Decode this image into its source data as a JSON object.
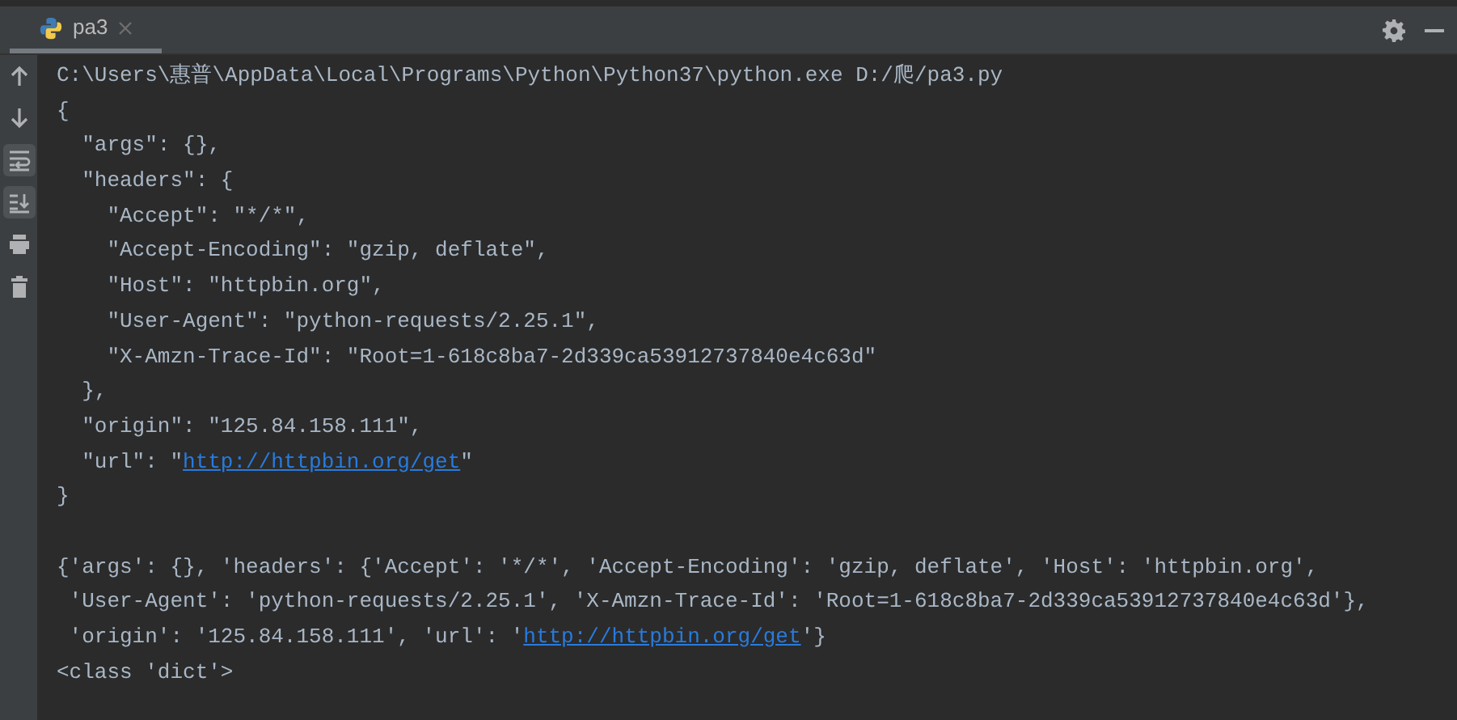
{
  "tabs": [
    {
      "label": "pa3",
      "selected": true
    }
  ],
  "toolbar": [
    {
      "kind": "up",
      "on": false
    },
    {
      "kind": "down",
      "on": false
    },
    {
      "kind": "wrap",
      "on": true
    },
    {
      "kind": "scroll",
      "on": true
    },
    {
      "kind": "print",
      "on": false
    },
    {
      "kind": "trash",
      "on": false
    }
  ],
  "console": {
    "lines": [
      {
        "kind": "output",
        "segments": [
          {
            "kind": "text",
            "text": "C:\\Users\\惠普\\AppData\\Local\\Programs\\Python\\Python37\\python.exe D:/爬/pa3.py"
          }
        ]
      },
      {
        "kind": "output",
        "segments": [
          {
            "kind": "text",
            "text": "{"
          }
        ]
      },
      {
        "kind": "output",
        "segments": [
          {
            "kind": "text",
            "text": "  \"args\": {},"
          }
        ]
      },
      {
        "kind": "output",
        "segments": [
          {
            "kind": "text",
            "text": "  \"headers\": {"
          }
        ]
      },
      {
        "kind": "output",
        "segments": [
          {
            "kind": "text",
            "text": "    \"Accept\": \"*/*\","
          }
        ]
      },
      {
        "kind": "output",
        "segments": [
          {
            "kind": "text",
            "text": "    \"Accept-Encoding\": \"gzip, deflate\","
          }
        ]
      },
      {
        "kind": "output",
        "segments": [
          {
            "kind": "text",
            "text": "    \"Host\": \"httpbin.org\","
          }
        ]
      },
      {
        "kind": "output",
        "segments": [
          {
            "kind": "text",
            "text": "    \"User-Agent\": \"python-requests/2.25.1\","
          }
        ]
      },
      {
        "kind": "output",
        "segments": [
          {
            "kind": "text",
            "text": "    \"X-Amzn-Trace-Id\": \"Root=1-618c8ba7-2d339ca53912737840e4c63d\""
          }
        ]
      },
      {
        "kind": "output",
        "segments": [
          {
            "kind": "text",
            "text": "  },"
          }
        ]
      },
      {
        "kind": "output",
        "segments": [
          {
            "kind": "text",
            "text": "  \"origin\": \"125.84.158.111\","
          }
        ]
      },
      {
        "kind": "output",
        "segments": [
          {
            "kind": "text",
            "text": "  \"url\": \""
          },
          {
            "kind": "link",
            "text": "http://httpbin.org/get"
          },
          {
            "kind": "text",
            "text": "\""
          }
        ]
      },
      {
        "kind": "output",
        "segments": [
          {
            "kind": "text",
            "text": "}"
          }
        ]
      },
      {
        "kind": "blank"
      },
      {
        "kind": "output",
        "segments": [
          {
            "kind": "text",
            "text": "{'args': {}, 'headers': {'Accept': '*/*', 'Accept-Encoding': 'gzip, deflate', 'Host': 'httpbin.org',"
          }
        ]
      },
      {
        "kind": "output",
        "segments": [
          {
            "kind": "text",
            "text": " 'User-Agent': 'python-requests/2.25.1', 'X-Amzn-Trace-Id': 'Root=1-618c8ba7-2d339ca53912737840e4c63d'},"
          }
        ]
      },
      {
        "kind": "output",
        "segments": [
          {
            "kind": "text",
            "text": " 'origin': '125.84.158.111', 'url': '"
          },
          {
            "kind": "link",
            "text": "http://httpbin.org/get"
          },
          {
            "kind": "text",
            "text": "'}"
          }
        ]
      },
      {
        "kind": "output",
        "segments": [
          {
            "kind": "text",
            "text": "<class 'dict'>"
          }
        ]
      }
    ]
  }
}
